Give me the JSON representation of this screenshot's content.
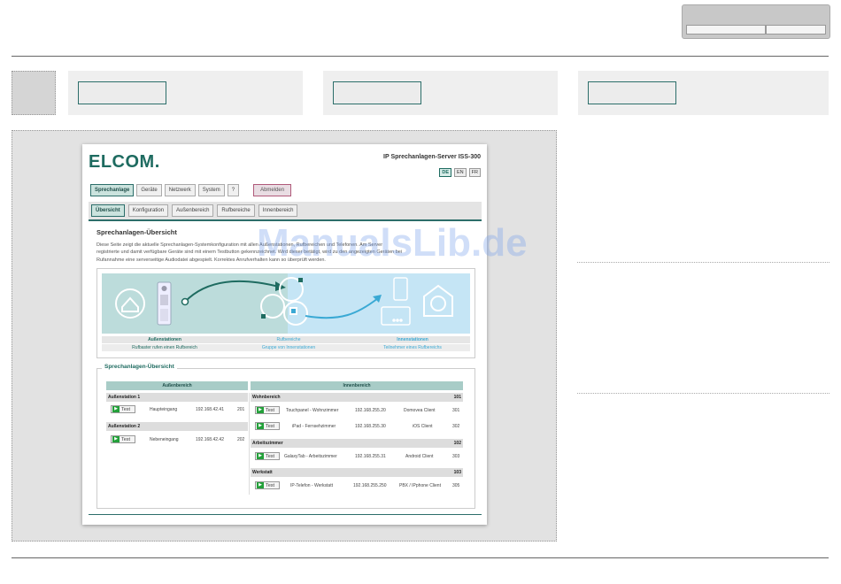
{
  "app": {
    "logo": "ELCOM.",
    "server_title": "IP Sprechanlagen-Server ISS-300",
    "languages": [
      "DE",
      "EN",
      "FR"
    ],
    "selected_language": "DE"
  },
  "nav_main": [
    "Sprechanlage",
    "Geräte",
    "Netzwerk",
    "System",
    "?"
  ],
  "nav_main_active": "Sprechanlage",
  "logout_label": "Abmelden",
  "nav_sub": [
    "Übersicht",
    "Konfiguration",
    "Außenbereich",
    "Rufbereiche",
    "Innenbereich"
  ],
  "nav_sub_active": "Übersicht",
  "page_title": "Sprechanlagen-Übersicht",
  "intro_lines": [
    "Diese Seite zeigt die aktuelle Sprechanlagen-Systemkonfiguration mit allen Außenstationen, Rufbereichen und Telefonen. Am Server",
    "registrierte und damit verfügbare Geräte sind mit einem Testbutton gekennzeichnet. Wird dieser betätigt, wird zu den angezeigten Geräten bei",
    "Rufannahme eine serverseitige Audiodatei abgespielt. Korrektes Anrufverhalten kann so überprüft werden."
  ],
  "diagram": {
    "labels": [
      {
        "title": "Außenstationen",
        "sub": "Rufbaster rufen einen Rufbereich"
      },
      {
        "title": "Rufbereiche",
        "sub": "Gruppe von Innenstationen"
      },
      {
        "title": "Innenstationen",
        "sub": "Teilnehmer eines Rufbereichs"
      }
    ],
    "colors": {
      "bg_left": "#bcdcdb",
      "bg_right": "#c5e5f5",
      "accent": "#1e6b60",
      "arrow": "#3aa9d4"
    }
  },
  "overview": {
    "legend": "Sprechanlagen-Übersicht",
    "col_outdoor": "Außenbereich",
    "col_indoor": "Innenbereich",
    "test_label": "Test",
    "outdoor": [
      {
        "name": "Außenstation 1",
        "location": "Haupteingang",
        "ip": "192.168.42.41",
        "num": "201"
      },
      {
        "name": "Außenstation 2",
        "location": "Nebeneingang",
        "ip": "192.168.42.42",
        "num": "202"
      }
    ],
    "zones": [
      {
        "name": "Wohnbereich",
        "num": "101",
        "devices": [
          {
            "name": "Touchpanel - Wohnzimmer",
            "ip": "192.168.255.20",
            "client": "Domovea Client",
            "num": "301"
          },
          {
            "name": "iPad - Fernsehzimmer",
            "ip": "192.168.255.30",
            "client": "iOS Client",
            "num": "302"
          }
        ]
      },
      {
        "name": "Arbeitszimmer",
        "num": "102",
        "devices": [
          {
            "name": "GalaxyTab - Arbeitszimmer",
            "ip": "192.168.255.31",
            "client": "Android Client",
            "num": "303"
          }
        ]
      },
      {
        "name": "Werkstatt",
        "num": "103",
        "devices": [
          {
            "name": "IP-Telefon - Werkstatt",
            "ip": "192.168.255.250",
            "client": "PBX / IPphone Client",
            "num": "305"
          }
        ]
      }
    ]
  },
  "watermark": "ManualsLib.de"
}
